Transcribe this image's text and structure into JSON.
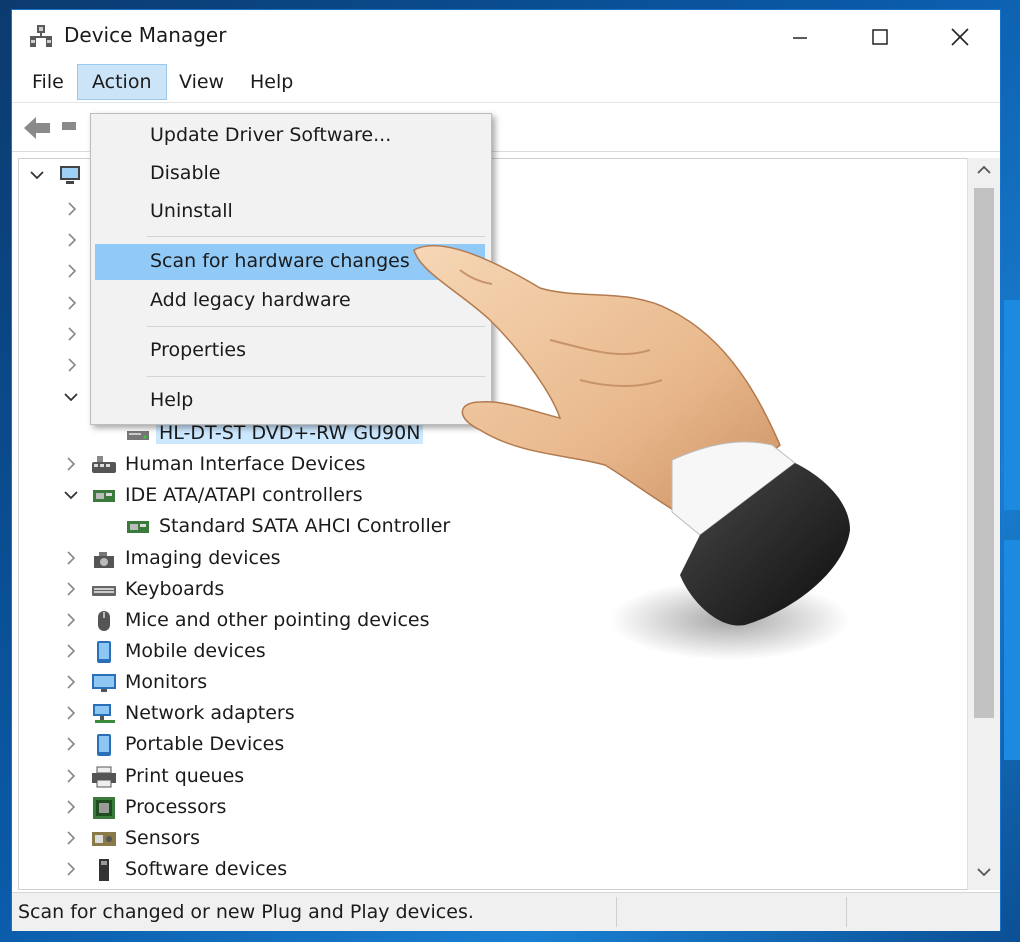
{
  "window": {
    "title": "Device Manager"
  },
  "menubar": {
    "items": [
      "File",
      "Action",
      "View",
      "Help"
    ],
    "active": "Action"
  },
  "action_menu": {
    "items": [
      {
        "label": "Update Driver Software..."
      },
      {
        "label": "Disable"
      },
      {
        "label": "Uninstall"
      },
      {
        "label": "Scan for hardware changes",
        "highlighted": true
      },
      {
        "label": "Add legacy hardware"
      },
      {
        "label": "Properties"
      },
      {
        "label": "Help"
      }
    ]
  },
  "tree": {
    "dvd_child": "HL-DT-ST DVD+-RW GU90N",
    "categories": [
      {
        "label": "Human Interface Devices",
        "icon": "hid-icon"
      },
      {
        "label": "IDE ATA/ATAPI controllers",
        "icon": "ide-controller-icon",
        "expanded": true
      },
      {
        "label": "Standard SATA AHCI Controller",
        "icon": "sata-controller-icon",
        "child": true
      },
      {
        "label": "Imaging devices",
        "icon": "camera-icon"
      },
      {
        "label": "Keyboards",
        "icon": "keyboard-icon"
      },
      {
        "label": "Mice and other pointing devices",
        "icon": "mouse-icon"
      },
      {
        "label": "Mobile devices",
        "icon": "mobile-icon"
      },
      {
        "label": "Monitors",
        "icon": "monitor-icon"
      },
      {
        "label": "Network adapters",
        "icon": "network-icon"
      },
      {
        "label": "Portable Devices",
        "icon": "portable-device-icon"
      },
      {
        "label": "Print queues",
        "icon": "printer-icon"
      },
      {
        "label": "Processors",
        "icon": "processor-icon"
      },
      {
        "label": "Sensors",
        "icon": "sensor-icon"
      },
      {
        "label": "Software devices",
        "icon": "software-device-icon"
      }
    ]
  },
  "statusbar": {
    "text": "Scan for changed or new Plug and Play devices."
  },
  "colors": {
    "accent": "#0078d7",
    "menu_highlight": "#91c9f7",
    "selection": "#cce8ff"
  }
}
